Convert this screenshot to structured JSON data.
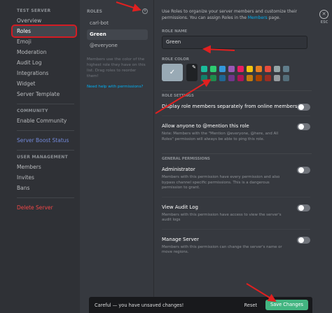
{
  "sidebar": {
    "server_header": "TEST SERVER",
    "items": [
      {
        "label": "Overview"
      },
      {
        "label": "Roles"
      },
      {
        "label": "Emoji"
      },
      {
        "label": "Moderation"
      },
      {
        "label": "Audit Log"
      },
      {
        "label": "Integrations"
      },
      {
        "label": "Widget"
      },
      {
        "label": "Server Template"
      }
    ],
    "community_header": "COMMUNITY",
    "community_item": "Enable Community",
    "boost_status": "Server Boost Status",
    "user_mgmt_header": "USER MANAGEMENT",
    "user_items": [
      {
        "label": "Members"
      },
      {
        "label": "Invites"
      },
      {
        "label": "Bans"
      }
    ],
    "delete_server": "Delete Server"
  },
  "roles_panel": {
    "header": "ROLES",
    "add_symbol": "+",
    "roles": [
      {
        "name": "carl-bot"
      },
      {
        "name": "Green"
      },
      {
        "name": "@everyone"
      }
    ],
    "note": "Members use the color of the highest role they have on this list. Drag roles to reorder them!",
    "help_link": "Need help with permissions?"
  },
  "main": {
    "description_part1": "Use Roles to organize your server members and customize their permissions. You can assign Roles in the",
    "description_link": "Members",
    "description_part2": "page.",
    "role_name_label": "ROLE NAME",
    "role_name_value": "Green",
    "role_color_label": "ROLE COLOR",
    "default_color_check": "✓",
    "picker_icon": "eyedropper-icon",
    "colors_row1": [
      "#1abc9c",
      "#2ecc71",
      "#3498db",
      "#9b59b6",
      "#e91e63",
      "#f1c40f",
      "#e67e22",
      "#e74c3c",
      "#95a5a6",
      "#607d8b"
    ],
    "colors_row2": [
      "#11806a",
      "#1f8b4c",
      "#206694",
      "#71368a",
      "#ad1457",
      "#c27c0e",
      "#a84300",
      "#992d22",
      "#979c9f",
      "#546e7a"
    ],
    "role_settings_header": "ROLE SETTINGS",
    "settings": [
      {
        "title": "Display role members separately from online members",
        "desc": ""
      },
      {
        "title": "Allow anyone to @mention this role",
        "desc": "Note: Members with the \"Mention @everyone, @here, and All Roles\" permission will always be able to ping this role."
      }
    ],
    "general_header": "GENERAL PERMISSIONS",
    "permissions": [
      {
        "title": "Administrator",
        "desc": "Members with this permission have every permission and also bypass channel specific permissions. This is a dangerous permission to grant."
      },
      {
        "title": "View Audit Log",
        "desc": "Members with this permission have access to view the server's audit logs"
      },
      {
        "title": "Manage Server",
        "desc": "Members with this permission can change the server's name or move regions."
      }
    ]
  },
  "close": {
    "symbol": "✕",
    "label": "ESC"
  },
  "notice": {
    "text": "Careful — you have unsaved changes!",
    "reset": "Reset",
    "save": "Save Changes"
  },
  "colors": {
    "annotation_arrow": "#e02020",
    "accent_green": "#43b581",
    "link_blue": "#00b0f4",
    "danger_red": "#f04747"
  }
}
